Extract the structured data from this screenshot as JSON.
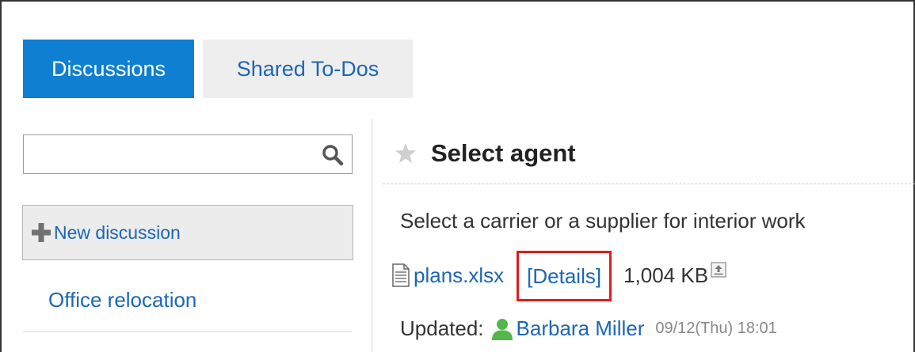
{
  "tabs": [
    {
      "label": "Discussions",
      "active": true
    },
    {
      "label": "Shared To-Dos",
      "active": false
    }
  ],
  "search": {
    "value": "",
    "placeholder": ""
  },
  "new_discussion": {
    "label": "New discussion"
  },
  "discussion_list": [
    {
      "label": "Office relocation"
    }
  ],
  "topic": {
    "title": "Select agent",
    "description": "Select a carrier or a supplier for interior work",
    "attachment": {
      "file_name": "plans.xlsx",
      "details_label": "[Details]",
      "size": "1,004 KB"
    },
    "updated": {
      "label": "Updated:",
      "user": "Barbara Miller",
      "timestamp": "09/12(Thu) 18:01"
    }
  },
  "colors": {
    "accent": "#0f7fd1",
    "link": "#1b67b7",
    "highlight": "#e31b1b",
    "user_icon": "#52b848"
  },
  "icons": [
    "search-icon",
    "plus-icon",
    "star-icon",
    "file-icon",
    "download-icon",
    "user-icon"
  ]
}
